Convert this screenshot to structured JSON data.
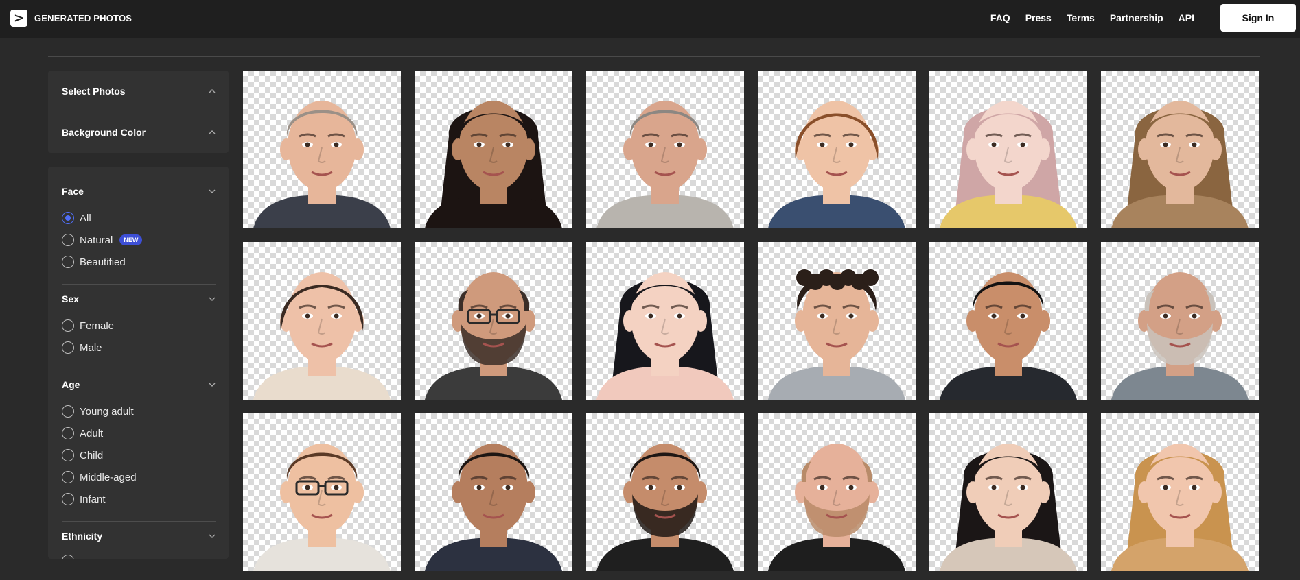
{
  "header": {
    "logo_glyph": ">",
    "brand": "GENERATED PHOTOS",
    "nav": [
      "FAQ",
      "Press",
      "Terms",
      "Partnership",
      "API"
    ],
    "signin_label": "Sign In"
  },
  "sidebar": {
    "top_sections": [
      {
        "title": "Select Photos",
        "state": "collapsed",
        "icon": "chevron-up-icon"
      },
      {
        "title": "Background Color",
        "state": "collapsed",
        "icon": "chevron-up-icon"
      }
    ],
    "face": {
      "title": "Face",
      "options": [
        "All",
        "Natural",
        "Beautified"
      ],
      "selected": "All",
      "natural_badge": "NEW"
    },
    "sex": {
      "title": "Sex",
      "options": [
        "Female",
        "Male"
      ]
    },
    "age": {
      "title": "Age",
      "options": [
        "Young adult",
        "Adult",
        "Child",
        "Middle-aged",
        "Infant"
      ]
    },
    "ethnicity": {
      "title": "Ethnicity"
    },
    "accent_color": "#4f6df5"
  },
  "photos": [
    {
      "label": "middle-aged man, grey hair",
      "skin": "#e7b69a",
      "hair": "#9b9087",
      "shirt": "#3b3f4a",
      "hairstyle": "short"
    },
    {
      "label": "young woman, long dark hair",
      "skin": "#b98563",
      "hair": "#1c1412",
      "shirt": "#1c1412",
      "hairstyle": "long"
    },
    {
      "label": "older man, grey hair",
      "skin": "#d9a58c",
      "hair": "#8c8782",
      "shirt": "#b8b4ae",
      "hairstyle": "short"
    },
    {
      "label": "woman, auburn hair",
      "skin": "#efc3a6",
      "hair": "#8a4f2a",
      "shirt": "#3a4f70",
      "hairstyle": "bob"
    },
    {
      "label": "woman, pink hair",
      "skin": "#f3d6cc",
      "hair": "#cfa6a6",
      "shirt": "#e6c86a",
      "hairstyle": "long"
    },
    {
      "label": "woman, light brown hair",
      "skin": "#e3b89c",
      "hair": "#8a6540",
      "shirt": "#a8835d",
      "hairstyle": "long"
    },
    {
      "label": "woman, brown bob",
      "skin": "#eec1a8",
      "hair": "#3a2a22",
      "shirt": "#e9dccd",
      "hairstyle": "bob"
    },
    {
      "label": "man, glasses, beard",
      "skin": "#cf9a7c",
      "hair": "#3b2e28",
      "shirt": "#3b3b3b",
      "hairstyle": "bald",
      "glasses": true,
      "beard": true
    },
    {
      "label": "young woman, black hair",
      "skin": "#f4d2c2",
      "hair": "#17171c",
      "shirt": "#f1c9bd",
      "hairstyle": "long"
    },
    {
      "label": "young man, curly hair",
      "skin": "#e6b598",
      "hair": "#2b1f19",
      "shirt": "#a7acb2",
      "hairstyle": "curly"
    },
    {
      "label": "young man, smiling",
      "skin": "#c98e6a",
      "hair": "#141212",
      "shirt": "#26292f",
      "hairstyle": "short"
    },
    {
      "label": "elderly man, white beard",
      "skin": "#d3a086",
      "hair": "#c9c2bb",
      "shirt": "#7d8790",
      "hairstyle": "bald",
      "beard": true
    },
    {
      "label": "young man, glasses",
      "skin": "#eec0a1",
      "hair": "#5b3a26",
      "shirt": "#e6e2dc",
      "hairstyle": "short",
      "glasses": true
    },
    {
      "label": "man, short dark hair",
      "skin": "#b57e5e",
      "hair": "#1d1613",
      "shirt": "#2c3140",
      "hairstyle": "short"
    },
    {
      "label": "man, beard",
      "skin": "#c58c6b",
      "hair": "#1f1714",
      "shirt": "#1f1f1f",
      "hairstyle": "short",
      "beard": true
    },
    {
      "label": "man, ginger beard",
      "skin": "#e6b19a",
      "hair": "#b88b69",
      "shirt": "#1e1e1e",
      "hairstyle": "bald",
      "beard": true
    },
    {
      "label": "woman, dark hair, smiling",
      "skin": "#f0cdb8",
      "hair": "#1b1616",
      "shirt": "#d6c7b9",
      "hairstyle": "long"
    },
    {
      "label": "woman, blonde hair",
      "skin": "#f1c6ad",
      "hair": "#c9934f",
      "shirt": "#d4a36a",
      "hairstyle": "long"
    }
  ]
}
